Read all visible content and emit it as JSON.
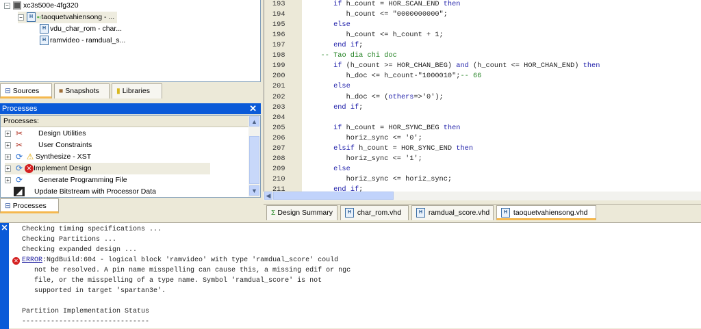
{
  "sources_tree": {
    "device": "xc3s500e-4fg320",
    "top_module": "taoquetvahiensong - ...",
    "children": [
      "vdu_char_rom - char...",
      "ramvideo - ramdual_s..."
    ]
  },
  "left_tabs": [
    "Sources",
    "Snapshots",
    "Libraries"
  ],
  "processes_panel": {
    "title": "Processes",
    "column_header": "Processes:",
    "items": [
      "Design Utilities",
      "User Constraints",
      "Synthesize - XST",
      "Implement Design",
      "Generate Programming File",
      "Update Bitstream with Processor Data"
    ],
    "tab": "Processes"
  },
  "editor": {
    "lines": [
      {
        "n": "193",
        "code": "      if h_count = HOR_SCAN_END then"
      },
      {
        "n": "194",
        "code": "         h_count <= \"0000000000\";"
      },
      {
        "n": "195",
        "code": "      else"
      },
      {
        "n": "196",
        "code": "         h_count <= h_count + 1;"
      },
      {
        "n": "197",
        "code": "      end if;"
      },
      {
        "n": "198",
        "code": "   -- Tao dia chi doc"
      },
      {
        "n": "199",
        "code": "      if (h_count >= HOR_CHAN_BEG) and (h_count <= HOR_CHAN_END) then"
      },
      {
        "n": "200",
        "code": "         h_doc <= h_count-\"1000010\";-- 66"
      },
      {
        "n": "201",
        "code": "      else"
      },
      {
        "n": "202",
        "code": "         h_doc <= (others=>'0');"
      },
      {
        "n": "203",
        "code": "      end if;"
      },
      {
        "n": "204",
        "code": ""
      },
      {
        "n": "205",
        "code": "      if h_count = HOR_SYNC_BEG then"
      },
      {
        "n": "206",
        "code": "         horiz_sync <= '0';"
      },
      {
        "n": "207",
        "code": "      elsif h_count = HOR_SYNC_END then"
      },
      {
        "n": "208",
        "code": "         horiz_sync <= '1';"
      },
      {
        "n": "209",
        "code": "      else"
      },
      {
        "n": "210",
        "code": "         horiz_sync <= horiz_sync;"
      },
      {
        "n": "211",
        "code": "      end if;"
      }
    ],
    "tabs": [
      "Design Summary",
      "char_rom.vhd",
      "ramdual_score.vhd",
      "taoquetvahiensong.vhd"
    ],
    "active_tab": "taoquetvahiensong.vhd"
  },
  "console": {
    "lines": [
      "Checking timing specifications ...",
      "Checking Partitions ...",
      "Checking expanded design ..."
    ],
    "error_link": "ERROR",
    "error_first": ":NgdBuild:604 - logical block 'ramvideo' with type 'ramdual_score' could",
    "error_cont": [
      "   not be resolved. A pin name misspelling can cause this, a missing edif or ngc",
      "   file, or the misspelling of a type name. Symbol 'ramdual_score' is not",
      "   supported in target 'spartan3e'."
    ],
    "status_title": "Partition Implementation Status",
    "separator": "-------------------------------"
  }
}
